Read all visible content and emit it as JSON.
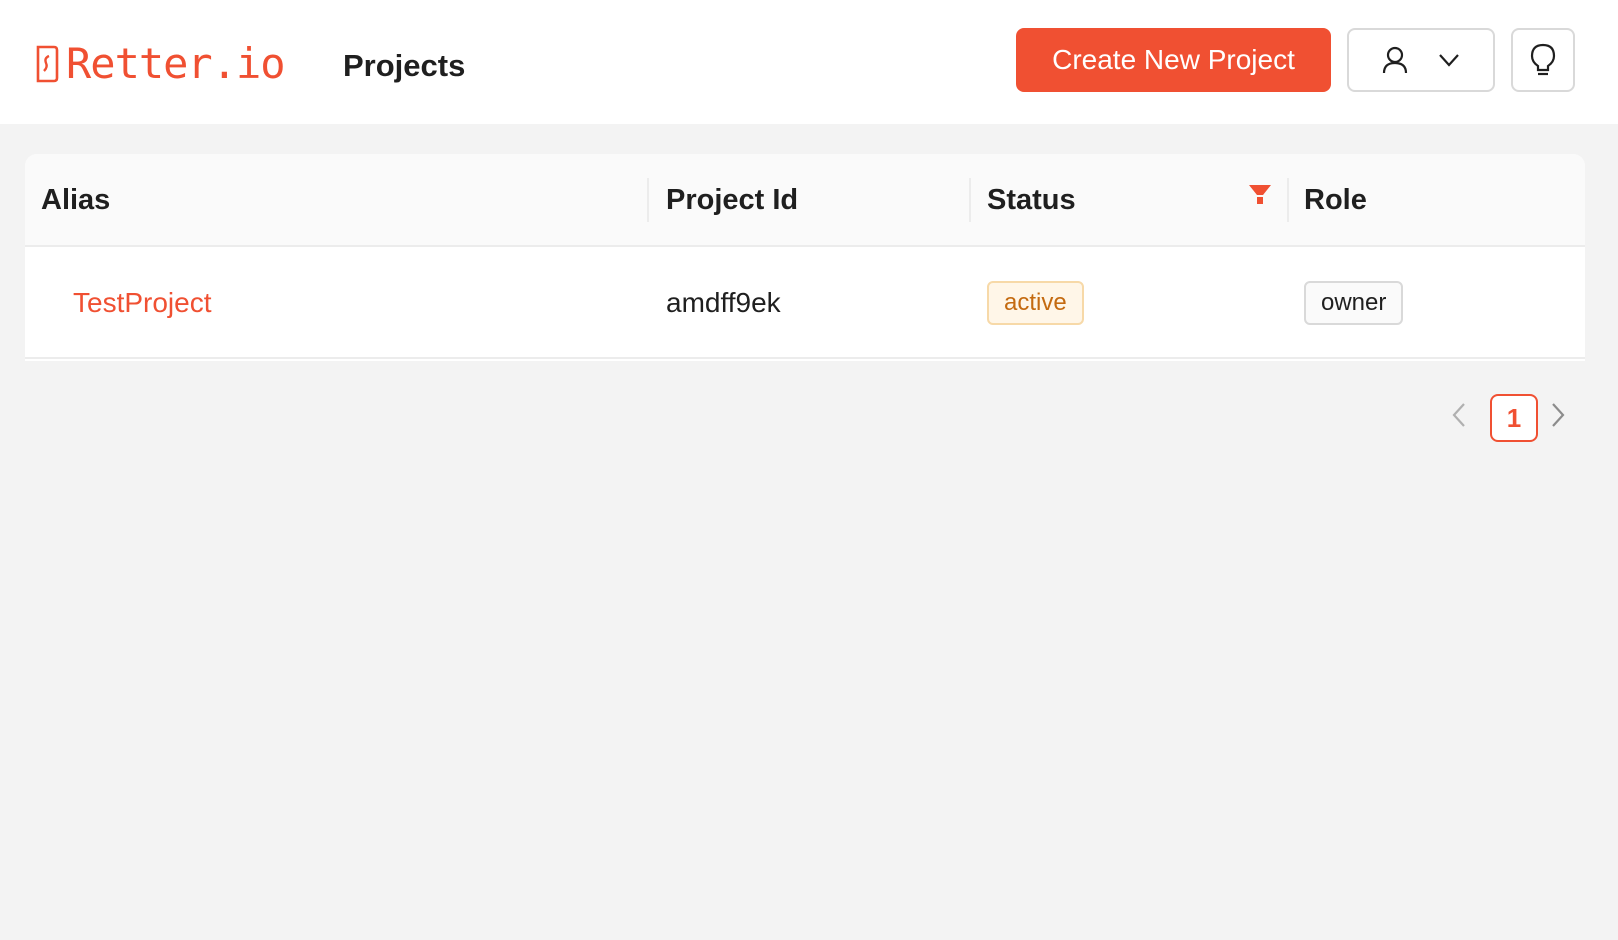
{
  "header": {
    "logo_text": "Retter.io",
    "page_title": "Projects",
    "create_button_label": "Create New Project",
    "user_menu_icon": "user-icon",
    "dropdown_icon": "chevron-down-icon",
    "hint_icon": "lightbulb-icon"
  },
  "table": {
    "columns": [
      {
        "label": "Alias"
      },
      {
        "label": "Project Id"
      },
      {
        "label": "Status",
        "filterable": true,
        "filter_icon": "filter-icon"
      },
      {
        "label": "Role"
      }
    ],
    "rows": [
      {
        "alias": "TestProject",
        "project_id": "amdff9ek",
        "status": "active",
        "role": "owner"
      }
    ]
  },
  "pagination": {
    "current_page": "1",
    "prev_icon": "chevron-left-icon",
    "next_icon": "chevron-right-icon"
  },
  "colors": {
    "brand": "#f05032",
    "status_active_bg": "#fff6e8",
    "status_active_text": "#c46a10",
    "page_background": "#f3f3f3"
  }
}
